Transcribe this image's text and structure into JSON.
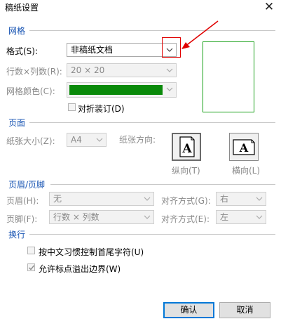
{
  "window": {
    "title": "稿纸设置"
  },
  "sections": {
    "grid": "网格",
    "page": "页面",
    "header_footer": "页眉/页脚",
    "line_break": "换行"
  },
  "grid": {
    "format_label": "格式(S):",
    "format_value": "非稿纸文档",
    "rows_cols_label": "行数×列数(R):",
    "rows_cols_value": "20 × 20",
    "color_label": "网格颜色(C):",
    "color_value": "#0a8a0a",
    "fold_binding_label": "对折装订(D)"
  },
  "page": {
    "paper_size_label": "纸张大小(Z):",
    "paper_size_value": "A4",
    "orientation_label": "纸张方向:",
    "portrait_label": "纵向(T)",
    "landscape_label": "横向(L)",
    "orientation_icon_text": "A"
  },
  "header_footer": {
    "header_label": "页眉(H):",
    "header_value": "无",
    "header_align_label": "对齐方式(G):",
    "header_align_value": "右",
    "footer_label": "页脚(F):",
    "footer_value": "行数 × 列数",
    "footer_align_label": "对齐方式(E):",
    "footer_align_value": "左"
  },
  "line_break": {
    "option1_label": "按中文习惯控制首尾字符(U)",
    "option2_label": "允许标点溢出边界(W)"
  },
  "buttons": {
    "ok": "确认",
    "cancel": "取消"
  },
  "colors": {
    "accent": "#1a56b4",
    "annotation": "#e00000",
    "grid_preview_border": "#19a019"
  }
}
